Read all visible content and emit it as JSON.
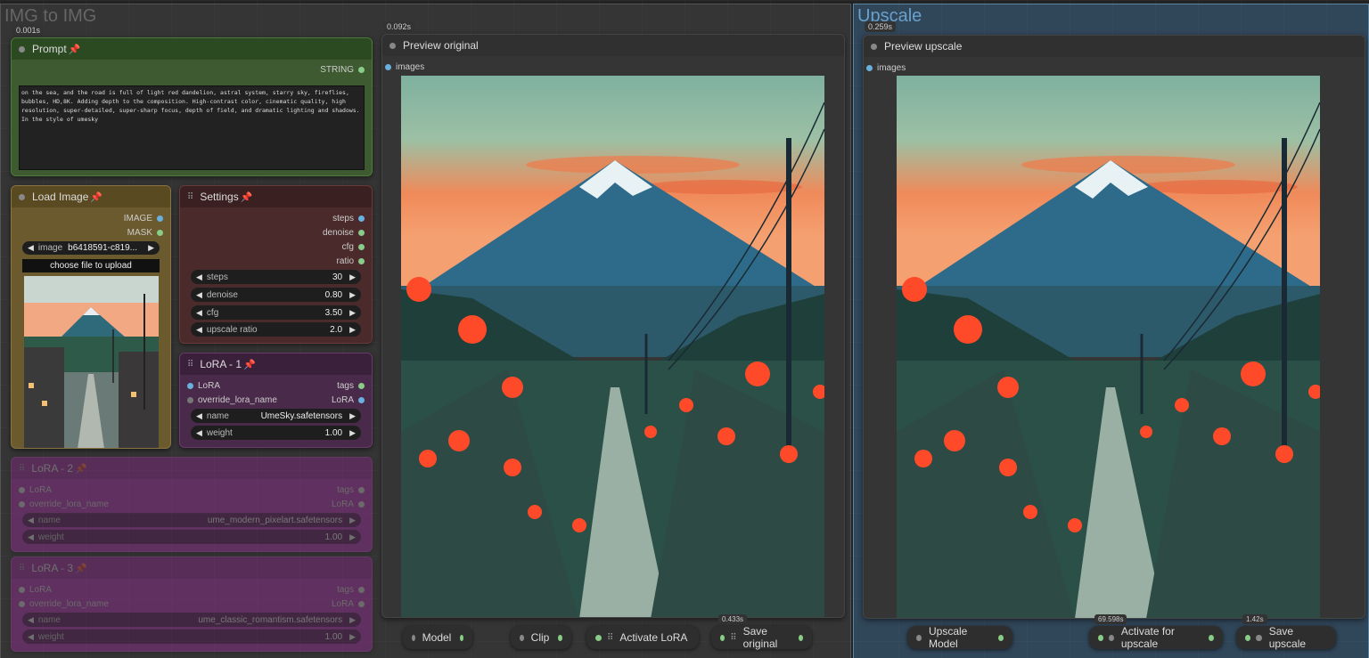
{
  "groups": {
    "img2img_title": "IMG to IMG",
    "upscale_title": "Upscale"
  },
  "timings": {
    "prompt": "0.001s",
    "preview_original": "0.092s",
    "preview_upscale": "0.259s",
    "btn_save_original": "0.433s",
    "btn_activate_upscale": "69.598s",
    "btn_save_upscale": "1.42s"
  },
  "prompt": {
    "title": "Prompt",
    "output": "STRING",
    "text": "on the sea, and the road is full of light red dandelion, astral system, starry sky, fireflies, bubbles, HD,8K. Adding depth to the composition. High-contrast color, cinematic quality, high resolution, super-detailed, super-sharp focus, depth of field, and dramatic lighting and shadows. In the style of umesky"
  },
  "load_image": {
    "title": "Load Image",
    "outputs": [
      "IMAGE",
      "MASK"
    ],
    "image_label": "image",
    "image_value": "b6418591-c819...",
    "upload_label": "choose file to upload"
  },
  "settings": {
    "title": "Settings",
    "outputs": [
      "steps",
      "denoise",
      "cfg",
      "ratio"
    ],
    "widgets": [
      {
        "label": "steps",
        "value": "30"
      },
      {
        "label": "denoise",
        "value": "0.80"
      },
      {
        "label": "cfg",
        "value": "3.50"
      },
      {
        "label": "upscale ratio",
        "value": "2.0"
      }
    ]
  },
  "lora1": {
    "title": "LoRA - 1",
    "in1": "LoRA",
    "in2": "override_lora_name",
    "out1": "tags",
    "out2": "LoRA",
    "name_label": "name",
    "name_value": "UmeSky.safetensors",
    "weight_label": "weight",
    "weight_value": "1.00"
  },
  "lora2": {
    "title": "LoRA - 2",
    "in1": "LoRA",
    "in2": "override_lora_name",
    "out1": "tags",
    "out2": "LoRA",
    "name_label": "name",
    "name_value": "ume_modern_pixelart.safetensors",
    "weight_label": "weight",
    "weight_value": "1.00"
  },
  "lora3": {
    "title": "LoRA - 3",
    "in1": "LoRA",
    "in2": "override_lora_name",
    "out1": "tags",
    "out2": "LoRA",
    "name_label": "name",
    "name_value": "ume_classic_romantism.safetensors",
    "weight_label": "weight",
    "weight_value": "1.00"
  },
  "preview_original": {
    "title": "Preview original",
    "input": "images"
  },
  "preview_upscale": {
    "title": "Preview upscale",
    "input": "images"
  },
  "buttons": {
    "model": "Model",
    "clip": "Clip",
    "activate_lora": "Activate LoRA",
    "save_original": "Save original",
    "upscale_model": "Upscale Model",
    "activate_upscale": "Activate for upscale",
    "save_upscale": "Save upscale"
  },
  "colors": {
    "prompt_node": "#3d5a30",
    "load_image_node": "#6b5a2e",
    "settings_node": "#4a2a2a",
    "lora_node": "#4a2a4a",
    "lora_faded_node": "#8a2a8a",
    "socket_image": "#6ab0de",
    "socket_green": "#8c8"
  }
}
